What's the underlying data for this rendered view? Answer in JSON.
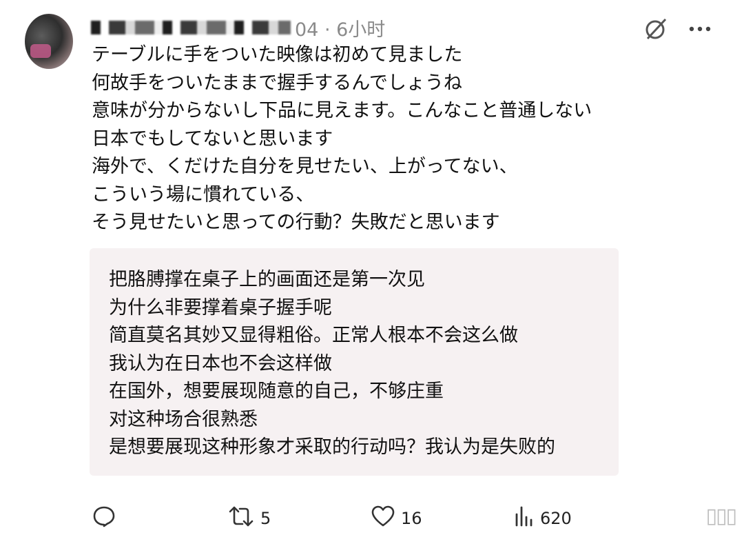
{
  "post": {
    "timestamp": "04 · 6小时",
    "lines": [
      "テーブルに手をついた映像は初めて見ました",
      "何故手をついたままで握手するんでしょうね",
      "意味が分からないし下品に見えます。こんなこと普通しない",
      "日本でもしてないと思います",
      "海外で、くだけた自分を見せたい、上がってない、",
      "こういう場に慣れている、",
      "そう見せたいと思っての行動？失敗だと思います"
    ]
  },
  "translation": {
    "lines": [
      "把胳膊撑在桌子上的画面还是第一次见",
      "为什么非要撑着桌子握手呢",
      "简直莫名其妙又显得粗俗。正常人根本不会这么做",
      "我认为在日本也不会这样做",
      "在国外，想要展现随意的自己，不够庄重",
      "对这种场合很熟悉",
      "是想要展现这种形象才采取的行动吗？我认为是失败的"
    ]
  },
  "actions": {
    "repost_count": "5",
    "like_count": "16",
    "views_count": "620"
  },
  "icons": {
    "top_right": [
      "grok-icon",
      "more-icon"
    ],
    "bottom": [
      "reply-icon",
      "repost-icon",
      "like-icon",
      "views-icon"
    ]
  }
}
